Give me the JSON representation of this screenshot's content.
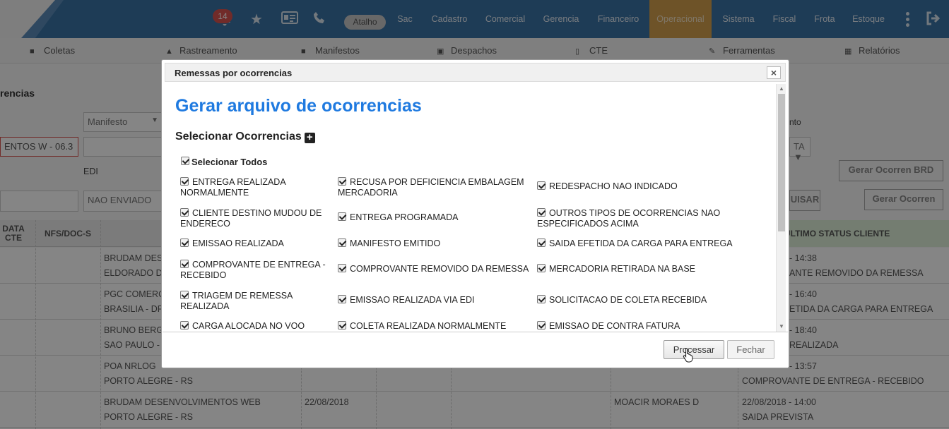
{
  "topnav": {
    "notification_count": "14",
    "atalho": "Atalho",
    "menu": [
      "Sac",
      "Cadastro",
      "Comercial",
      "Gerencia",
      "Financeiro",
      "Operacional",
      "Sistema",
      "Fiscal",
      "Frota",
      "Estoque"
    ],
    "active_menu": "Operacional",
    "accent_color": "#d4a04e",
    "bar_color": "#3a73a5"
  },
  "subnav": [
    "Coletas",
    "Rastreamento",
    "Manifestos",
    "Despachos",
    "CTE",
    "Ferramentas",
    "Relatórios"
  ],
  "background": {
    "panel_title": "rencias",
    "manifesto_select": "Manifesto",
    "eventos_field": "ENTOS W - 06.3",
    "edi_label": "EDI",
    "nao_enviado_field": "NAO ENVIADO",
    "evento_label_fragment": "nto",
    "ta_select_fragment": "TA",
    "btn_gerar_brd": "Gerar Ocorren BRD",
    "btn_uisar": "UISAR",
    "btn_gerar": "Gerar Ocorren",
    "table_headers": {
      "data_cte": "DATA CTE",
      "nfs_doc": "NFS/DOC-S",
      "ultimo_status": "ÚLTIMO STATUS CLIENTE"
    },
    "rows": [
      {
        "cliente": "BRUDAM DESE",
        "cidade": "ELDORADO DO",
        "status_time": "- 14:38",
        "status": "ANTE REMOVIDO DA REMESSA",
        "date": "",
        "resp": ""
      },
      {
        "cliente": "PGC COMERC",
        "cidade": "BRASILIA - DF",
        "status_time": "- 16:40",
        "status": "ETIDA DA CARGA PARA ENTREGA",
        "date": "",
        "resp": ""
      },
      {
        "cliente": "BRUNO BERG",
        "cidade": "SAO PAULO - S",
        "status_time": "- 18:40",
        "status": "REALIZADA",
        "date": "",
        "resp": ""
      },
      {
        "cliente": "POA NRLOG",
        "cidade": "PORTO ALEGRE - RS",
        "status_time": "- 13:57",
        "status": "COMPROVANTE DE ENTREGA - RECEBIDO",
        "date": "",
        "resp": ""
      },
      {
        "cliente": "BRUDAM DESENVOLVIMENTOS WEB",
        "cidade": "PORTO ALEGRE - RS",
        "status_time": "22/08/2018 - 14:00",
        "status": "SAIDA PREVISTA",
        "date": "22/08/2018",
        "resp": "MOACIR MORAES D"
      }
    ]
  },
  "modal": {
    "title": "Remessas por ocorrencias",
    "heading": "Gerar arquivo de ocorrencias",
    "section_label": "Selecionar Ocorrencias",
    "select_all": "Selecionar Todos",
    "heading_color": "#1f7ae0",
    "options": [
      [
        "ENTREGA REALIZADA NORMALMENTE",
        "RECUSA POR DEFICIENCIA EMBALAGEM MERCADORIA",
        "REDESPACHO NAO INDICADO"
      ],
      [
        "CLIENTE DESTINO MUDOU DE ENDERECO",
        "ENTREGA PROGRAMADA",
        "OUTROS TIPOS DE OCORRENCIAS NAO ESPECIFICADOS ACIMA"
      ],
      [
        "EMISSAO REALIZADA",
        "MANIFESTO EMITIDO",
        "SAIDA EFETIDA DA CARGA PARA ENTREGA"
      ],
      [
        "COMPROVANTE DE ENTREGA - RECEBIDO",
        "COMPROVANTE REMOVIDO DA REMESSA",
        "MERCADORIA RETIRADA NA BASE"
      ],
      [
        "TRIAGEM DE REMESSA REALIZADA",
        "EMISSAO REALIZADA VIA EDI",
        "SOLICITACAO DE COLETA RECEBIDA"
      ],
      [
        "CARGA ALOCADA NO VOO",
        "COLETA REALIZADA NORMALMENTE",
        "EMISSAO DE CONTRA FATURA"
      ]
    ],
    "btn_processar": "Processar",
    "btn_fechar": "Fechar"
  }
}
